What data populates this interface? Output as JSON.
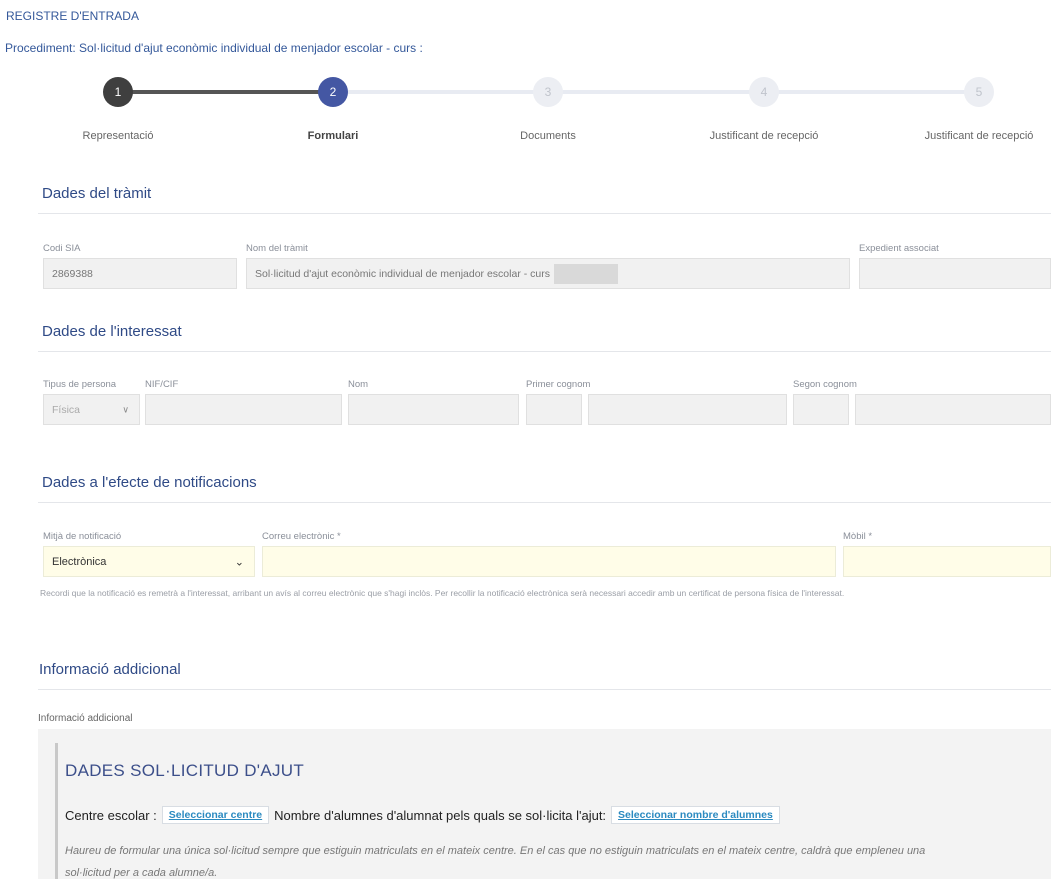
{
  "header": {
    "title": "REGISTRE D'ENTRADA",
    "procedure": "Procediment: Sol·licitud d'ajut econòmic individual de menjador escolar - curs :"
  },
  "steps": [
    {
      "number": "1",
      "label": "Representació",
      "state": "done"
    },
    {
      "number": "2",
      "label": "Formulari",
      "state": "active"
    },
    {
      "number": "3",
      "label": "Documents",
      "state": "pending"
    },
    {
      "number": "4",
      "label": "Justificant de recepció",
      "state": "pending"
    },
    {
      "number": "5",
      "label": "Justificant de recepció",
      "state": "pending"
    }
  ],
  "tramit": {
    "title": "Dades del tràmit",
    "codi_label": "Codi SIA",
    "codi_value": "2869388",
    "nom_label": "Nom del tràmit",
    "nom_value": "Sol·licitud d'ajut econòmic individual de menjador escolar - curs",
    "exp_label": "Expedient associat",
    "exp_value": ""
  },
  "interessat": {
    "title": "Dades de l'interessat",
    "tipus_label": "Tipus de persona",
    "tipus_value": "Física",
    "nif_label": "NIF/CIF",
    "nom_label": "Nom",
    "cognom1_label": "Primer cognom",
    "cognom2_label": "Segon cognom"
  },
  "notificacions": {
    "title": "Dades a l'efecte de notificacions",
    "mitja_label": "Mitjà de notificació",
    "mitja_value": "Electrònica",
    "correu_label": "Correu electrònic *",
    "mobil_label": "Mòbil *",
    "hint": "Recordi que la notificació es remetrà a l'interessat, arribant un avís al correu electrònic que s'hagi inclòs. Per recollir la notificació electrònica serà necessari accedir amb un certificat de persona física de l'interessat."
  },
  "addicional": {
    "title": "Informació addicional",
    "label": "Informació addicional",
    "panel_title": "DADES SOL·LICITUD D'AJUT",
    "centre_label": "Centre escolar :",
    "centre_link": "Seleccionar centre",
    "alumnes_label": "Nombre d'alumnes d'alumnat pels quals se sol·licita l'ajut:",
    "alumnes_link": "Seleccionar nombre d'alumnes",
    "note_line1": "Haureu de formular una única sol·licitud sempre que estiguin matriculats en el mateix centre. En el cas que no estiguin matriculats en el mateix centre, caldrà que empleneu una",
    "note_line2": "sol·licitud per a cada alumne/a."
  },
  "icons": {
    "select_chevron": "chevron-down-icon"
  }
}
